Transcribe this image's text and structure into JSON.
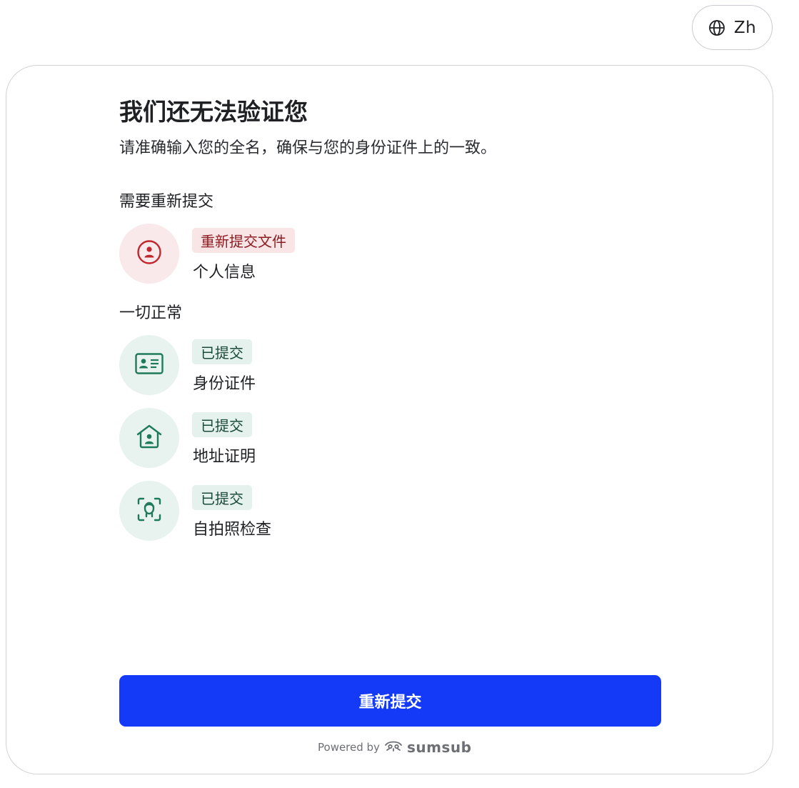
{
  "language": {
    "label": "Zh",
    "icon": "globe-icon"
  },
  "header": {
    "title": "我们还无法验证您",
    "subtitle": "请准确输入您的全名，确保与您的身份证件上的一致。"
  },
  "sections": {
    "resubmit": {
      "label": "需要重新提交",
      "items": [
        {
          "icon": "person-icon",
          "badge": "重新提交文件",
          "name": "个人信息",
          "status_color": "#c0262e"
        }
      ]
    },
    "ok": {
      "label": "一切正常",
      "items": [
        {
          "icon": "id-card-icon",
          "badge": "已提交",
          "name": "身份证件",
          "status_color": "#1f7a5a"
        },
        {
          "icon": "home-person-icon",
          "badge": "已提交",
          "name": "地址证明",
          "status_color": "#1f7a5a"
        },
        {
          "icon": "face-scan-icon",
          "badge": "已提交",
          "name": "自拍照检查",
          "status_color": "#1f7a5a"
        }
      ]
    }
  },
  "actions": {
    "resubmit_label": "重新提交"
  },
  "footer": {
    "powered_by": "Powered by",
    "brand": "sumsub",
    "brand_icon": "sumsub-logo-icon"
  },
  "colors": {
    "primary": "#1439f7",
    "error": "#c0262e",
    "success": "#1f7a5a"
  }
}
